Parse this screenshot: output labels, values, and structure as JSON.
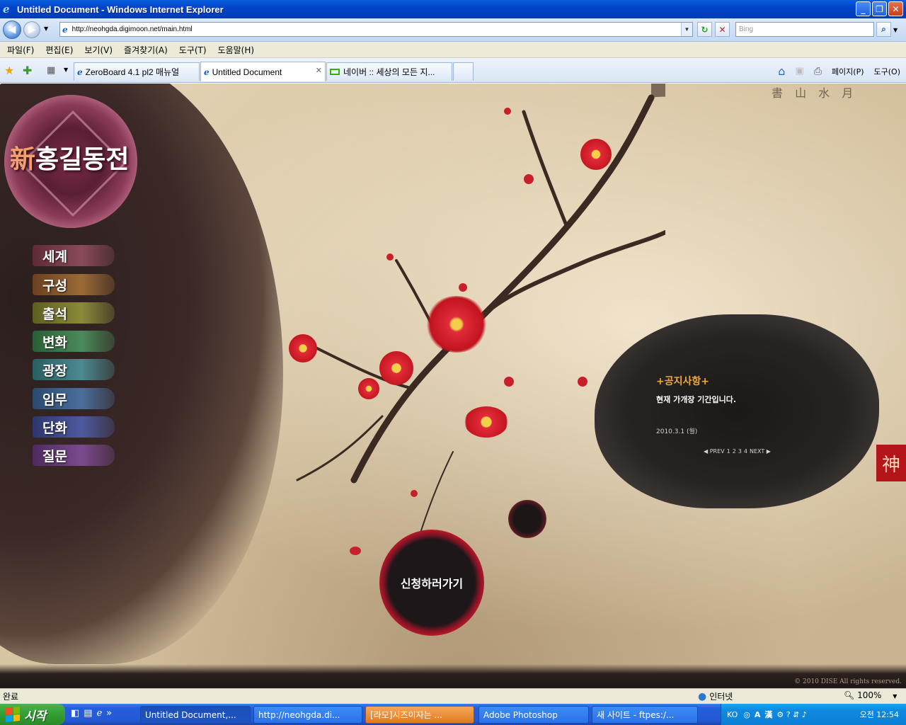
{
  "window": {
    "title": "Untitled Document - Windows Internet Explorer",
    "min": "_",
    "max": "❐",
    "close": "✕"
  },
  "address": {
    "url": "http://neohgda.digimoon.net/main.html",
    "search_placeholder": "Bing"
  },
  "menu": [
    "파일(F)",
    "편집(E)",
    "보기(V)",
    "즐겨찾기(A)",
    "도구(T)",
    "도움말(H)"
  ],
  "tabs": [
    {
      "label": "ZeroBoard 4.1 pl2 매뉴얼"
    },
    {
      "label": "Untitled Document"
    },
    {
      "label": "네이버 :: 세상의 모든 지..."
    }
  ],
  "toolbar_right": {
    "page": "페이지(P)",
    "tools": "도구(O)"
  },
  "site": {
    "logo_hanja": "新",
    "logo_text": "홍길동전",
    "nav": [
      {
        "label": "세계",
        "color": "#7a3a4a"
      },
      {
        "label": "구성",
        "color": "#8a5a30"
      },
      {
        "label": "출석",
        "color": "#7a7a30"
      },
      {
        "label": "변화",
        "color": "#3f7a4a"
      },
      {
        "label": "광장",
        "color": "#3a7a7e"
      },
      {
        "label": "임무",
        "color": "#3a5e8a"
      },
      {
        "label": "단화",
        "color": "#3e4a8e"
      },
      {
        "label": "질문",
        "color": "#6a3a7e"
      }
    ],
    "notice": {
      "title": "+공지사항+",
      "body": "현재 가개장 기간입니다.",
      "date": "2010.3.1 (월)",
      "pager": [
        "◀ PREV",
        "1",
        "2",
        "3",
        "4",
        "NEXT ▶"
      ]
    },
    "apply_label": "신청하러가기",
    "stamp": "神",
    "copyright": "© 2010 DISE All rights reserved."
  },
  "status": {
    "text": "완료",
    "zone": "인터넷",
    "zoom": "100%"
  },
  "taskbar": {
    "start": "시작",
    "buttons": [
      "Untitled Document,...",
      "http://neohgda.di...",
      "[라모]시즈이자는 ...",
      "Adobe Photoshop",
      "새 사이트 - ftpes:/..."
    ],
    "tray_lang": "KO",
    "clock": "오전 12:54"
  }
}
